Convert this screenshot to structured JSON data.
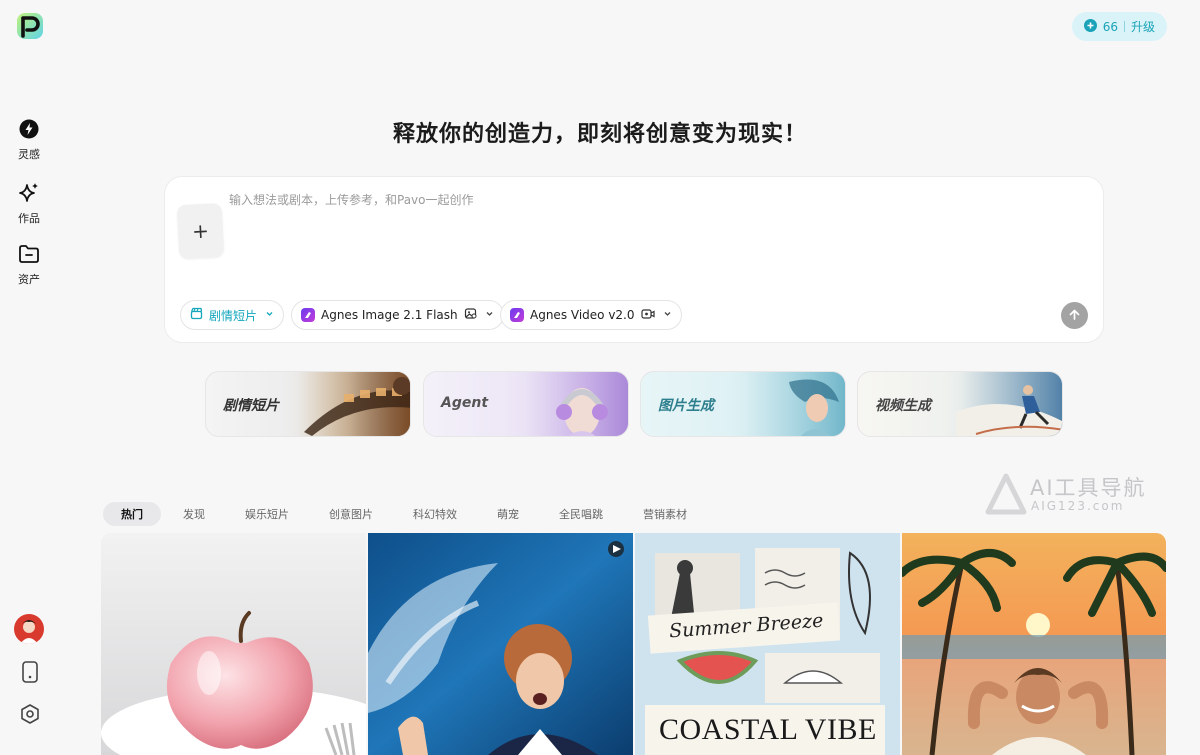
{
  "brand": {
    "logo_letter": "P",
    "logo_icon": "pavo-logo-icon"
  },
  "sidebar": {
    "items": [
      {
        "label": "灵感",
        "icon": "lightning-icon"
      },
      {
        "label": "作品",
        "icon": "sparkle-icon"
      },
      {
        "label": "资产",
        "icon": "folder-icon"
      }
    ],
    "bottom_icons": [
      "avatar",
      "phone-icon",
      "hexagon-settings-icon"
    ]
  },
  "credits": {
    "count": "66",
    "upgrade_label": "升级",
    "icon": "plus-circle-icon"
  },
  "headline": "释放你的创造力，即刻将创意变为现实！",
  "prompt": {
    "placeholder": "输入想法或剧本，上传参考，和Pavo一起创作",
    "upload_symbol": "+",
    "chips": [
      {
        "label": "剧情短片",
        "icon": "clapperboard-icon"
      },
      {
        "label": "Agnes Image 2.1 Flash",
        "icon": "image-settings-icon"
      },
      {
        "label": "Agnes Video v2.0",
        "icon": "video-settings-icon"
      }
    ],
    "send_icon": "arrow-up-icon"
  },
  "modes": [
    {
      "label": "剧情短片"
    },
    {
      "label": "Agent"
    },
    {
      "label": "图片生成"
    },
    {
      "label": "视频生成"
    }
  ],
  "watermark": {
    "line1": "AI工具导航",
    "line2": "AIG123.com"
  },
  "tabs": [
    "热门",
    "发现",
    "娱乐短片",
    "创意图片",
    "科幻特效",
    "萌宠",
    "全民唱跳",
    "营销素材"
  ],
  "gallery": {
    "cards": [
      {
        "subject": "pink glass apple"
      },
      {
        "subject": "girl in water splash",
        "badge_icon": "play-icon"
      },
      {
        "subject": "collage",
        "text_top": "Summer Breeze",
        "text_bottom": "COASTAL VIBE"
      },
      {
        "subject": "man on beach at sunset"
      }
    ]
  },
  "colors": {
    "accent": "#14a6bd",
    "credits_bg": "#d9f3f8",
    "page_bg": "#f7f7f8"
  }
}
